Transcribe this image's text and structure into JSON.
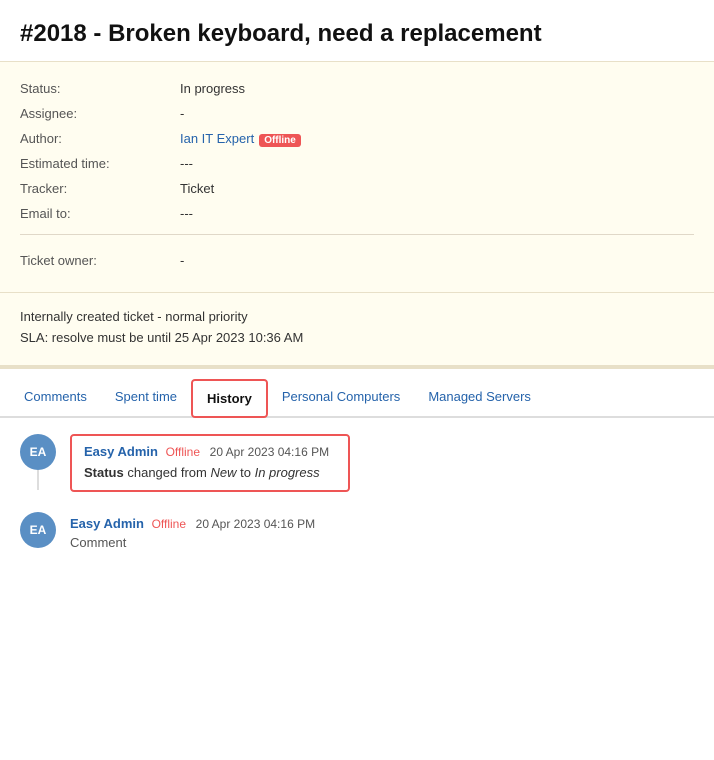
{
  "page": {
    "title": "#2018 - Broken keyboard, need a replacement"
  },
  "ticket": {
    "status_label": "Status:",
    "status_value": "In progress",
    "assignee_label": "Assignee:",
    "assignee_value": "-",
    "author_label": "Author:",
    "author_name": "Ian IT Expert",
    "author_status": "Offline",
    "estimated_label": "Estimated time:",
    "estimated_value": "---",
    "tracker_label": "Tracker:",
    "tracker_value": "Ticket",
    "email_label": "Email to:",
    "email_value": "---",
    "owner_label": "Ticket owner:",
    "owner_value": "-",
    "note1": "Internally created ticket - normal priority",
    "note2": "SLA: resolve must be until 25 Apr 2023 10:36 AM"
  },
  "tabs": {
    "items": [
      {
        "id": "comments",
        "label": "Comments",
        "active": false
      },
      {
        "id": "spent-time",
        "label": "Spent time",
        "active": false
      },
      {
        "id": "history",
        "label": "History",
        "active": true
      },
      {
        "id": "personal-computers",
        "label": "Personal Computers",
        "active": false
      },
      {
        "id": "managed-servers",
        "label": "Managed Servers",
        "active": false
      }
    ]
  },
  "history": {
    "entries": [
      {
        "id": "entry1",
        "avatar_initials": "EA",
        "author": "Easy Admin",
        "author_status": "Offline",
        "timestamp": "20 Apr 2023 04:16 PM",
        "detail_prefix": "Status",
        "detail_changed": "changed from",
        "detail_from": "New",
        "detail_to_text": "to",
        "detail_to": "In progress",
        "highlighted": true
      },
      {
        "id": "entry2",
        "avatar_initials": "EA",
        "author": "Easy Admin",
        "author_status": "Offline",
        "timestamp": "20 Apr 2023 04:16 PM",
        "comment_text": "Comment",
        "highlighted": false
      }
    ]
  }
}
